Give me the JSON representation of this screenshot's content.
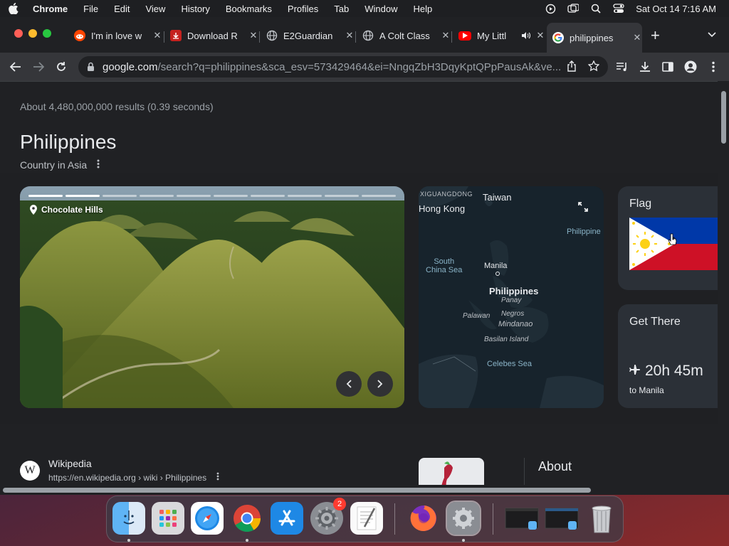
{
  "menubar": {
    "app_name": "Chrome",
    "menus": [
      "File",
      "Edit",
      "View",
      "History",
      "Bookmarks",
      "Profiles",
      "Tab",
      "Window",
      "Help"
    ],
    "datetime": "Sat Oct 14  7:16 AM"
  },
  "tabs": [
    {
      "title": "I'm in love w",
      "icon": "reddit-icon",
      "color": "#ff4500"
    },
    {
      "title": "Download R",
      "icon": "download-app-icon",
      "color": "#c5221f"
    },
    {
      "title": "E2Guardian",
      "icon": "globe-icon",
      "color": "#9aa0a6"
    },
    {
      "title": "A Colt Class",
      "icon": "globe-icon",
      "color": "#9aa0a6"
    },
    {
      "title": "My Littl",
      "icon": "youtube-icon",
      "color": "#ff0000"
    },
    {
      "title": "philippines",
      "icon": "google-icon",
      "color": "#4285f4",
      "active": true
    }
  ],
  "address": {
    "host": "google.com",
    "path": "/search?q=philippines&sca_esv=573429464&ei=NngqZbH3DqyKptQPpPausAk&ve..."
  },
  "results": {
    "stats": "About 4,480,000,000 results (0.39 seconds)"
  },
  "knowledge_panel": {
    "title": "Philippines",
    "subtitle": "Country in Asia",
    "hero_label": "Chocolate Hills",
    "progress_segments": 10,
    "progress_done": 2,
    "map_labels": {
      "guangdong": "XIGUANGDONG",
      "taiwan": "Taiwan",
      "hong_kong": "Hong Kong",
      "philippine_sea": "Philippine",
      "south_china_sea": "South\nChina Sea",
      "manila": "Manila",
      "philippines": "Philippines",
      "panay": "Panay",
      "palawan": "Palawan",
      "negros": "Negros",
      "mindanao": "Mindanao",
      "basilan": "Basilan Island",
      "celebes": "Celebes Sea"
    },
    "flag_heading": "Flag",
    "get_there_heading": "Get There",
    "travel_time": "20h 45m",
    "travel_dest": "to Manila"
  },
  "wikipedia": {
    "name": "Wikipedia",
    "url": "https://en.wikipedia.org › wiki › Philippines",
    "logo_letter": "W"
  },
  "about_heading": "About",
  "dock": {
    "apps": [
      "Finder",
      "Launchpad",
      "Safari",
      "Chrome",
      "App Store",
      "System Preferences",
      "TextEdit",
      "Firefox",
      "System Preferences",
      "Window 1",
      "Window 2",
      "Trash"
    ],
    "settings_badge": "2"
  },
  "colors": {
    "accent_red": "#ce1126",
    "accent_blue": "#0038a8",
    "flag_yellow": "#fcd116"
  }
}
